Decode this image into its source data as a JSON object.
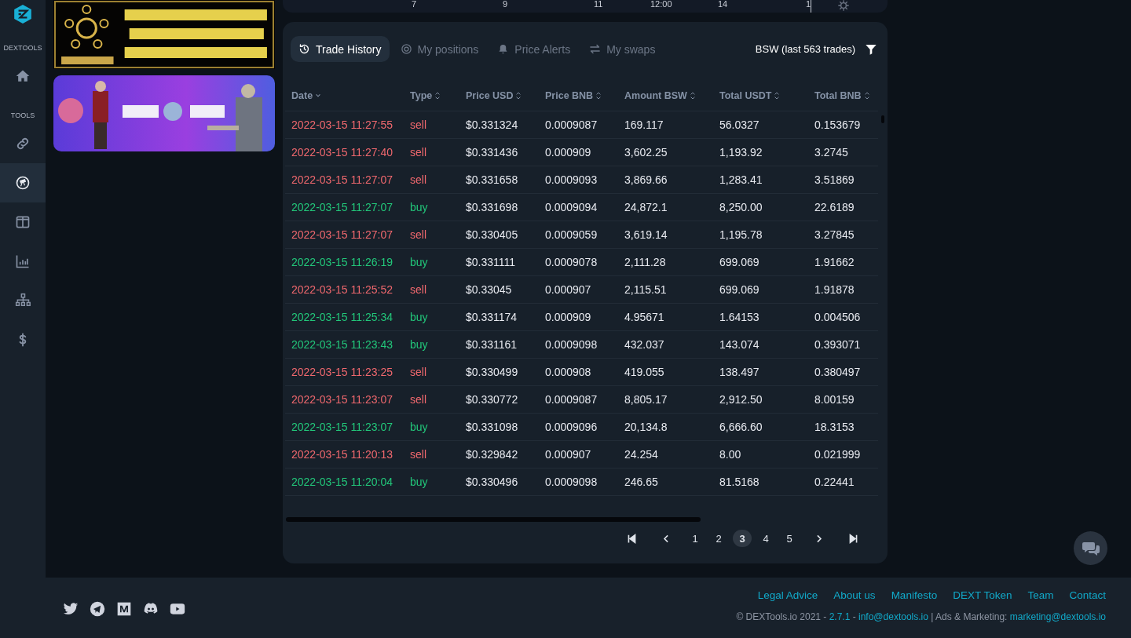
{
  "sidebar": {
    "brand": "DEXTOOLS",
    "section_label": "TOOLS",
    "items": [
      {
        "kind": "home",
        "selected": false
      },
      {
        "kind": "link",
        "selected": false
      },
      {
        "kind": "explorer",
        "selected": true
      },
      {
        "kind": "columns",
        "selected": false
      },
      {
        "kind": "stats",
        "selected": false
      },
      {
        "kind": "tree",
        "selected": false
      },
      {
        "kind": "dollar",
        "selected": false
      }
    ]
  },
  "banners": [
    {
      "kind": "picture"
    },
    {
      "kind": "picture"
    }
  ],
  "chart_axis": [
    "7",
    "9",
    "11",
    "12:00",
    "14",
    "1"
  ],
  "tabs": [
    {
      "label": "Trade History",
      "selected": true
    },
    {
      "label": "My positions",
      "selected": false
    },
    {
      "label": "Price Alerts",
      "selected": false
    },
    {
      "label": "My swaps",
      "selected": false
    }
  ],
  "trades_summary": "BSW (last 563 trades)",
  "table": {
    "columns": [
      "Date",
      "Type",
      "Price USD",
      "Price BNB",
      "Amount BSW",
      "Total USDT",
      "Total BNB"
    ],
    "rows": [
      {
        "kind": "sell",
        "cells": [
          "2022-03-15 11:27:55",
          "sell",
          "$0.331324",
          "0.0009087",
          "169.117",
          "56.0327",
          "0.153679"
        ]
      },
      {
        "kind": "sell",
        "cells": [
          "2022-03-15 11:27:40",
          "sell",
          "$0.331436",
          "0.000909",
          "3,602.25",
          "1,193.92",
          "3.2745"
        ]
      },
      {
        "kind": "sell",
        "cells": [
          "2022-03-15 11:27:07",
          "sell",
          "$0.331658",
          "0.0009093",
          "3,869.66",
          "1,283.41",
          "3.51869"
        ]
      },
      {
        "kind": "buy",
        "cells": [
          "2022-03-15 11:27:07",
          "buy",
          "$0.331698",
          "0.0009094",
          "24,872.1",
          "8,250.00",
          "22.6189"
        ]
      },
      {
        "kind": "sell",
        "cells": [
          "2022-03-15 11:27:07",
          "sell",
          "$0.330405",
          "0.0009059",
          "3,619.14",
          "1,195.78",
          "3.27845"
        ]
      },
      {
        "kind": "buy",
        "cells": [
          "2022-03-15 11:26:19",
          "buy",
          "$0.331111",
          "0.0009078",
          "2,111.28",
          "699.069",
          "1.91662"
        ]
      },
      {
        "kind": "sell",
        "cells": [
          "2022-03-15 11:25:52",
          "sell",
          "$0.33045",
          "0.000907",
          "2,115.51",
          "699.069",
          "1.91878"
        ]
      },
      {
        "kind": "buy",
        "cells": [
          "2022-03-15 11:25:34",
          "buy",
          "$0.331174",
          "0.000909",
          "4.95671",
          "1.64153",
          "0.004506"
        ]
      },
      {
        "kind": "buy",
        "cells": [
          "2022-03-15 11:23:43",
          "buy",
          "$0.331161",
          "0.0009098",
          "432.037",
          "143.074",
          "0.393071"
        ]
      },
      {
        "kind": "sell",
        "cells": [
          "2022-03-15 11:23:25",
          "sell",
          "$0.330499",
          "0.000908",
          "419.055",
          "138.497",
          "0.380497"
        ]
      },
      {
        "kind": "sell",
        "cells": [
          "2022-03-15 11:23:07",
          "sell",
          "$0.330772",
          "0.0009087",
          "8,805.17",
          "2,912.50",
          "8.00159"
        ]
      },
      {
        "kind": "buy",
        "cells": [
          "2022-03-15 11:23:07",
          "buy",
          "$0.331098",
          "0.0009096",
          "20,134.8",
          "6,666.60",
          "18.3153"
        ]
      },
      {
        "kind": "sell",
        "cells": [
          "2022-03-15 11:20:13",
          "sell",
          "$0.329842",
          "0.000907",
          "24.254",
          "8.00",
          "0.021999"
        ]
      },
      {
        "kind": "buy",
        "cells": [
          "2022-03-15 11:20:04",
          "buy",
          "$0.330496",
          "0.0009098",
          "246.65",
          "81.5168",
          "0.22441"
        ]
      }
    ]
  },
  "pagination": {
    "pages": [
      {
        "label": "1",
        "selected": false
      },
      {
        "label": "2",
        "selected": false
      },
      {
        "label": "3",
        "selected": true
      },
      {
        "label": "4",
        "selected": false
      },
      {
        "label": "5",
        "selected": false
      }
    ]
  },
  "footer": {
    "links": [
      "Legal Advice",
      "About us",
      "Manifesto",
      "DEXT Token",
      "Team",
      "Contact"
    ],
    "copyright": [
      {
        "text": "© DEXTools.io 2021 - ",
        "link": false
      },
      {
        "text": "2.7.1",
        "link": true
      },
      {
        "text": " - ",
        "link": false
      },
      {
        "text": "info@dextools.io",
        "link": true
      },
      {
        "text": " | Ads & Marketing: ",
        "link": false
      },
      {
        "text": "marketing@dextools.io",
        "link": true
      }
    ]
  }
}
